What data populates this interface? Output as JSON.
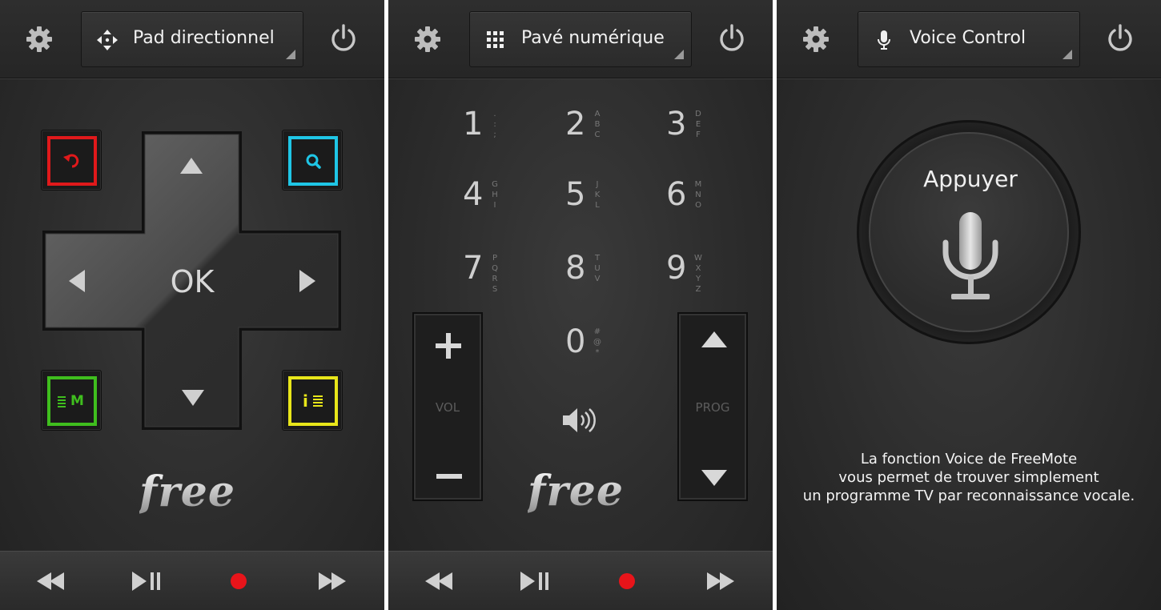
{
  "panels": [
    {
      "mode_label": "Pad directionnel",
      "mode_icon": "directional-arrows-icon"
    },
    {
      "mode_label": "Pavé numérique",
      "mode_icon": "keypad-grid-icon"
    },
    {
      "mode_label": "Voice Control",
      "mode_icon": "microphone-icon"
    }
  ],
  "dpad": {
    "ok_label": "OK"
  },
  "color_buttons": {
    "back": {
      "color": "#e0191b",
      "icon": "back-arrow-icon"
    },
    "search": {
      "color": "#1fc6e6",
      "icon": "search-icon"
    },
    "menu": {
      "color": "#3fbe1e",
      "icon": "menu-m-icon",
      "label": "M"
    },
    "info": {
      "color": "#e8e61a",
      "icon": "info-list-icon",
      "label": "i"
    }
  },
  "brand": {
    "text": "free"
  },
  "keypad": {
    "keys": [
      {
        "num": "1",
        "letters": [
          ".",
          ":",
          ";"
        ]
      },
      {
        "num": "2",
        "letters": [
          "A",
          "B",
          "C"
        ]
      },
      {
        "num": "3",
        "letters": [
          "D",
          "E",
          "F"
        ]
      },
      {
        "num": "4",
        "letters": [
          "G",
          "H",
          "I"
        ]
      },
      {
        "num": "5",
        "letters": [
          "J",
          "K",
          "L"
        ]
      },
      {
        "num": "6",
        "letters": [
          "M",
          "N",
          "O"
        ]
      },
      {
        "num": "7",
        "letters": [
          "P",
          "Q",
          "R",
          "S"
        ]
      },
      {
        "num": "8",
        "letters": [
          "T",
          "U",
          "V"
        ]
      },
      {
        "num": "9",
        "letters": [
          "W",
          "X",
          "Y",
          "Z"
        ]
      },
      {
        "num": "0",
        "letters": [
          "#",
          "@",
          "*"
        ]
      }
    ],
    "vol_label": "VOL",
    "prog_label": "PROG",
    "mute_icon": "speaker-icon"
  },
  "transport": {
    "icons": [
      "rewind-icon",
      "play-pause-icon",
      "record-icon",
      "fast-forward-icon"
    ],
    "record_color": "#e8141a"
  },
  "voice": {
    "button_label": "Appuyer",
    "description_lines": [
      "La fonction Voice de FreeMote",
      "vous permet de trouver simplement",
      "un programme TV par reconnaissance vocale."
    ]
  }
}
